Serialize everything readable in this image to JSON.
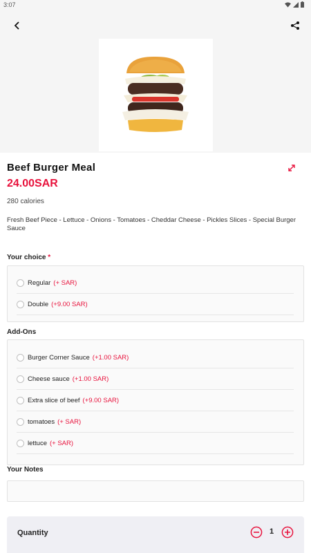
{
  "status_bar": {
    "time": "3:07"
  },
  "product": {
    "name": "Beef Burger Meal",
    "price": "24.00SAR",
    "calories": "280 calories",
    "description": "Fresh Beef Piece - Lettuce - Onions - Tomatoes - Cheddar Cheese - Pickles Slices - Special Burger Sauce"
  },
  "choice": {
    "label": "Your choice",
    "required_mark": "*",
    "options": [
      {
        "name": "Regular",
        "price": "(+ SAR)"
      },
      {
        "name": "Double",
        "price": "(+9.00 SAR)"
      }
    ]
  },
  "addons": {
    "label": "Add-Ons",
    "options": [
      {
        "name": "Burger Corner Sauce",
        "price": "(+1.00 SAR)"
      },
      {
        "name": "Cheese sauce",
        "price": "(+1.00 SAR)"
      },
      {
        "name": "Extra slice of beef",
        "price": "(+9.00 SAR)"
      },
      {
        "name": "tomatoes",
        "price": "(+ SAR)"
      },
      {
        "name": "lettuce",
        "price": "(+ SAR)"
      }
    ]
  },
  "notes": {
    "label": "Your Notes",
    "value": ""
  },
  "quantity": {
    "label": "Quantity",
    "value": "1"
  },
  "colors": {
    "accent": "#e8123c",
    "background": "#f5f5f5"
  },
  "icons": [
    "back-arrow-icon",
    "share-icon",
    "expand-icon",
    "minus-circle-icon",
    "plus-circle-icon",
    "wifi-icon",
    "signal-icon",
    "battery-icon"
  ]
}
